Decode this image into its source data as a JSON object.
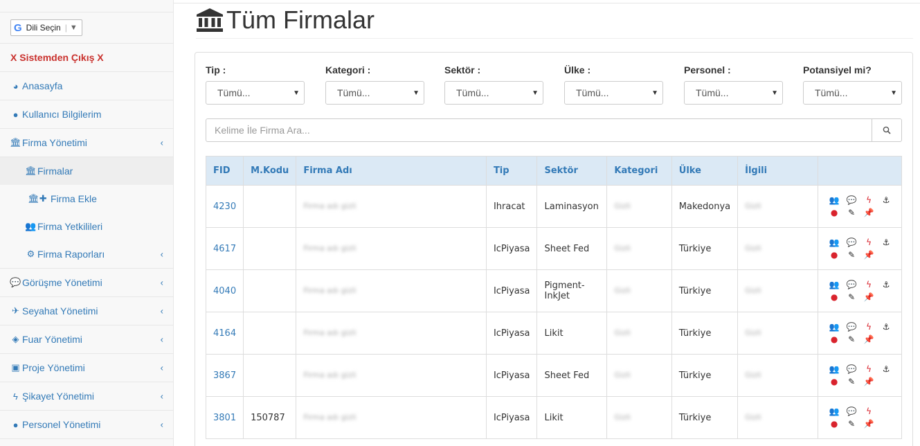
{
  "sidebar": {
    "language_label": "Dili Seçin",
    "logout_label": "X Sistemden Çıkış X",
    "items": [
      {
        "label": "Anasayfa",
        "icon": "dashboard-icon",
        "chevron": false
      },
      {
        "label": "Kullanıcı Bilgilerim",
        "icon": "user-icon",
        "chevron": false
      },
      {
        "label": "Firma Yönetimi",
        "icon": "bank-icon",
        "chevron": true
      }
    ],
    "subitems": [
      {
        "label": "Firmalar",
        "icon": "bank-icon",
        "active": true,
        "chevron": false
      },
      {
        "label": "Firma Ekle",
        "icon": "bank-plus-icon",
        "active": false,
        "chevron": false
      },
      {
        "label": "Firma Yetkilileri",
        "icon": "users-icon",
        "active": false,
        "chevron": false
      },
      {
        "label": "Firma Raporları",
        "icon": "cogs-icon",
        "active": false,
        "chevron": true
      }
    ],
    "items2": [
      {
        "label": "Görüşme Yönetimi",
        "icon": "comments-icon",
        "chevron": true
      },
      {
        "label": "Seyahat Yönetimi",
        "icon": "plane-icon",
        "chevron": true
      },
      {
        "label": "Fuar Yönetimi",
        "icon": "tag-icon",
        "chevron": true
      },
      {
        "label": "Proje Yönetimi",
        "icon": "cube-icon",
        "chevron": true
      },
      {
        "label": "Şikayet Yönetimi",
        "icon": "bolt-icon",
        "chevron": true
      },
      {
        "label": "Personel Yönetimi",
        "icon": "user-icon",
        "chevron": true
      }
    ]
  },
  "page": {
    "title": "Tüm Firmalar"
  },
  "filters": [
    {
      "label": "Tip :",
      "value": "Tümü..."
    },
    {
      "label": "Kategori :",
      "value": "Tümü..."
    },
    {
      "label": "Sektör :",
      "value": "Tümü..."
    },
    {
      "label": "Ülke :",
      "value": "Tümü..."
    },
    {
      "label": "Personel :",
      "value": "Tümü..."
    },
    {
      "label": "Potansiyel mi?",
      "value": "Tümü..."
    }
  ],
  "search": {
    "placeholder": "Kelime İle Firma Ara..."
  },
  "table": {
    "headers": [
      "FID",
      "M.Kodu",
      "Firma Adı",
      "Tip",
      "Sektör",
      "Kategori",
      "Ülke",
      "İlgili",
      ""
    ],
    "rows": [
      {
        "fid": "4230",
        "mkodu": "",
        "firma": "Firma adı gizli",
        "tip": "Ihracat",
        "sektor": "Laminasyon",
        "kategori": "Gizli",
        "ulke": "Makedonya",
        "ilgili": "Gizli",
        "anchor": true
      },
      {
        "fid": "4617",
        "mkodu": "",
        "firma": "Firma adı gizli",
        "tip": "IcPiyasa",
        "sektor": "Sheet Fed",
        "kategori": "Gizli",
        "ulke": "Türkiye",
        "ilgili": "Gizli",
        "anchor": true
      },
      {
        "fid": "4040",
        "mkodu": "",
        "firma": "Firma adı gizli",
        "tip": "IcPiyasa",
        "sektor": "Pigment-InkJet",
        "kategori": "Gizli",
        "ulke": "Türkiye",
        "ilgili": "Gizli",
        "anchor": true
      },
      {
        "fid": "4164",
        "mkodu": "",
        "firma": "Firma adı gizli",
        "tip": "IcPiyasa",
        "sektor": "Likit",
        "kategori": "Gizli",
        "ulke": "Türkiye",
        "ilgili": "Gizli",
        "anchor": true
      },
      {
        "fid": "3867",
        "mkodu": "",
        "firma": "Firma adı gizli",
        "tip": "IcPiyasa",
        "sektor": "Sheet Fed",
        "kategori": "Gizli",
        "ulke": "Türkiye",
        "ilgili": "Gizli",
        "anchor": true
      },
      {
        "fid": "3801",
        "mkodu": "150787",
        "firma": "Firma adı gizli",
        "tip": "IcPiyasa",
        "sektor": "Likit",
        "kategori": "Gizli",
        "ulke": "Türkiye",
        "ilgili": "Gizli",
        "anchor": false
      }
    ]
  },
  "colors": {
    "link": "#337ab7",
    "logout": "#c9302c",
    "header_bg": "#dbe9f5"
  }
}
